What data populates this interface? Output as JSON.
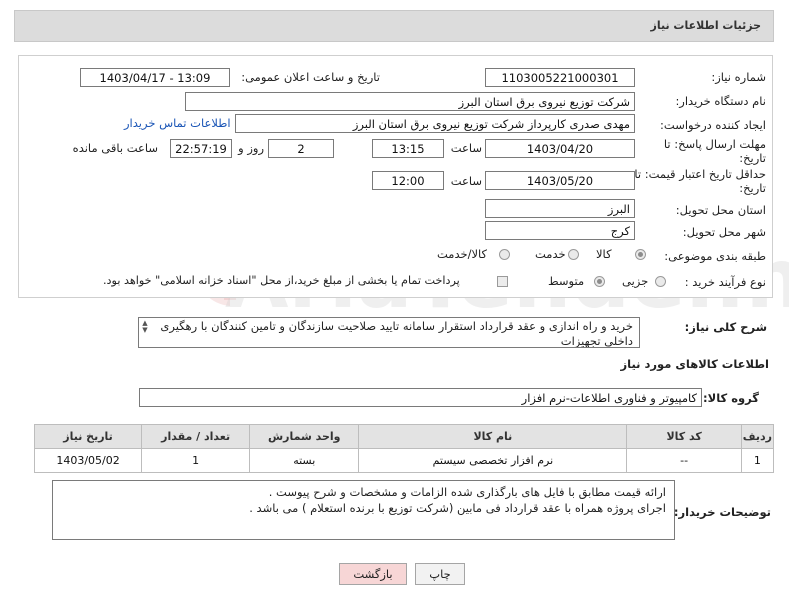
{
  "header": {
    "title": "جزئیات اطلاعات نیاز"
  },
  "form": {
    "need_number": {
      "label": "شماره نیاز:",
      "value": "1103005221000301"
    },
    "announce_datetime": {
      "label": "تاریخ و ساعت اعلان عمومی:",
      "value": "1403/04/17 - 13:09"
    },
    "buyer_org": {
      "label": "نام دستگاه خریدار:",
      "value": "شرکت توزیع نیروی برق استان البرز"
    },
    "requester": {
      "label": "ایجاد کننده درخواست:",
      "value": "مهدی صدری کارپرداز شرکت توزیع نیروی برق استان البرز"
    },
    "buyer_contact_link": "اطلاعات تماس خریدار",
    "reply_deadline": {
      "label_line1": "مهلت ارسال پاسخ: تا",
      "label_line2": "تاریخ:",
      "date": "1403/04/20",
      "time_label": "ساعت",
      "time": "13:15",
      "days": "2",
      "days_label": "روز و",
      "remaining": "22:57:19",
      "remaining_label": "ساعت باقی مانده"
    },
    "price_validity": {
      "label_line1": "حداقل تاریخ اعتبار قیمت: تا",
      "label_line2": "تاریخ:",
      "date": "1403/05/20",
      "time_label": "ساعت",
      "time": "12:00"
    },
    "delivery_province": {
      "label": "استان محل تحویل:",
      "value": "البرز"
    },
    "delivery_city": {
      "label": "شهر محل تحویل:",
      "value": "کرج"
    },
    "category": {
      "label": "طبقه بندی موضوعی:",
      "options": [
        "کالا",
        "خدمت",
        "کالا/خدمت"
      ],
      "selected": "کالا"
    },
    "purchase_type": {
      "label": "نوع فرآیند خرید :",
      "options": [
        "جزیی",
        "متوسط"
      ],
      "selected": "متوسط",
      "treasury_note": "پرداخت تمام یا بخشی از مبلغ خرید،از محل \"اسناد خزانه اسلامی\" خواهد بود."
    }
  },
  "general_description": {
    "label": "شرح کلی نیاز:",
    "text": "خرید و راه اندازی و عقد قرارداد استقرار سامانه تایید صلاحیت سازندگان و تامین کنندگان با رهگیری داخلی تجهیزات"
  },
  "goods_section": {
    "title": "اطلاعات کالاهای مورد نیاز",
    "group_label": "گروه کالا:",
    "group_value": "کامپیوتر و فناوری اطلاعات-نرم افزار"
  },
  "items_table": {
    "headers": [
      "ردیف",
      "کد کالا",
      "نام کالا",
      "واحد شمارش",
      "تعداد / مقدار",
      "تاریخ نیاز"
    ],
    "rows": [
      [
        "1",
        "--",
        "نرم افزار تخصصی سیستم",
        "بسته",
        "1",
        "1403/05/02"
      ]
    ]
  },
  "buyer_notes": {
    "label": "توضیحات خریدار:",
    "line1": "ارائه قیمت مطابق با فایل های بارگذاری شده الزامات و مشخصات و شرح پیوست .",
    "line2": "اجرای پروژه همراه با عقد قرارداد فی مابین (شرکت توزیع با برنده استعلام ) می باشد ."
  },
  "buttons": {
    "print": "چاپ",
    "back": "بازگشت"
  },
  "watermark": {
    "text": "AriaTender.net"
  },
  "colors": {
    "header_bg": "#dcdcdc",
    "table_header_bg": "#e3e3e3",
    "link": "#1a55b6",
    "back_button_bg": "#f7d6d6",
    "print_button_bg": "#f2f2f2"
  }
}
